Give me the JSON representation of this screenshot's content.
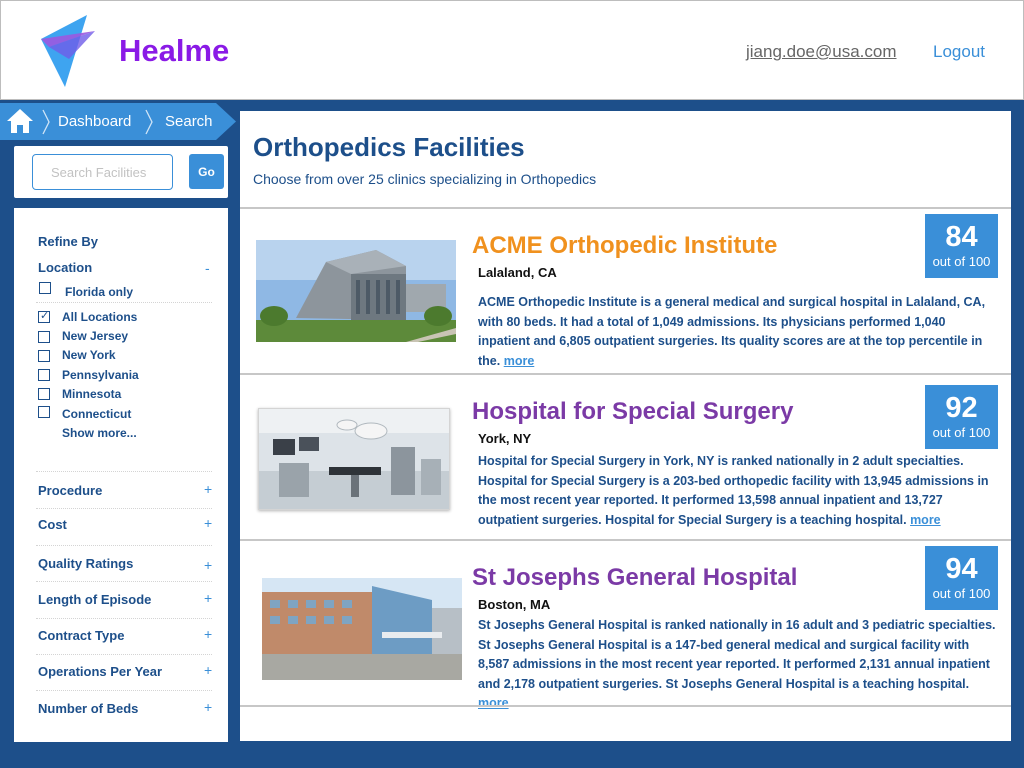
{
  "header": {
    "brand": "Healme",
    "user_email": "jiang.doe@usa.com",
    "logout_label": "Logout",
    "brand_color": "#8a1ae6",
    "accent_color": "#3a8fd8"
  },
  "breadcrumb": {
    "home_icon": "home-icon",
    "items": [
      "Dashboard",
      "Search"
    ]
  },
  "search": {
    "placeholder": "Search Facilities",
    "value": "",
    "go_label": "Go"
  },
  "filters": {
    "refine_title": "Refine By",
    "location": {
      "title": "Location",
      "toggle": "-",
      "options": [
        {
          "label": "Florida only",
          "checked": false
        },
        {
          "label": "All Locations",
          "checked": true
        },
        {
          "label": "New Jersey",
          "checked": false
        },
        {
          "label": "New York",
          "checked": false
        },
        {
          "label": "Pennsylvania",
          "checked": false
        },
        {
          "label": "Minnesota",
          "checked": false
        },
        {
          "label": "Connecticut",
          "checked": false
        }
      ],
      "show_more": "Show more..."
    },
    "sections": [
      {
        "title": "Procedure",
        "toggle": "+"
      },
      {
        "title": "Cost",
        "toggle": "+"
      },
      {
        "title": "Quality Ratings",
        "toggle": "+"
      },
      {
        "title": "Length of Episode",
        "toggle": "+"
      },
      {
        "title": "Contract Type",
        "toggle": "+"
      },
      {
        "title": "Operations Per Year",
        "toggle": "+"
      },
      {
        "title": "Number of Beds",
        "toggle": "+"
      }
    ]
  },
  "main": {
    "title": "Orthopedics Facilities",
    "subtitle": "Choose from over 25 clinics specializing in Orthopedics",
    "results": [
      {
        "name": "ACME Orthopedic Institute",
        "name_color": "#f0911e",
        "location": "Lalaland, CA",
        "description": "ACME Orthopedic Institute is a general medical and surgical hospital in Lalaland, CA, with 80 beds. It had a total of 1,049 admissions. Its physicians performed 1,040 inpatient and 6,805 outpatient surgeries. Its quality scores are at the top percentile in the.",
        "more_label": "more",
        "score": "84",
        "score_out_of": "out of 100"
      },
      {
        "name": "Hospital for Special Surgery",
        "name_color": "#7b3aa6",
        "location": "York, NY",
        "description": "Hospital for Special Surgery in York, NY is ranked nationally in 2 adult specialties. Hospital for Special Surgery is a 203-bed orthopedic facility with 13,945 admissions in the most recent year reported. It performed 13,598 annual inpatient and 13,727 outpatient surgeries. Hospital for Special Surgery is a teaching hospital.",
        "more_label": "more",
        "score": "92",
        "score_out_of": "out of 100"
      },
      {
        "name": "St Josephs General Hospital",
        "name_color": "#7b3aa6",
        "location": "Boston, MA",
        "description": "St Josephs General Hospital is ranked nationally in 16 adult and 3 pediatric specialties. St Josephs General Hospital is a 147-bed general medical and surgical facility with 8,587 admissions in the most recent year reported. It performed 2,131 annual inpatient and 2,178 outpatient surgeries. St Josephs General Hospital is a teaching hospital.",
        "more_label": "more",
        "score": "94",
        "score_out_of": "out of 100"
      }
    ]
  }
}
